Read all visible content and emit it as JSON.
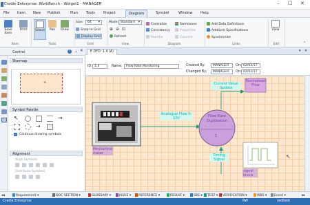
{
  "window": {
    "title": "Cradle Enterprise: WorkBench - Widget1 - MANAGER"
  },
  "menu": {
    "items": [
      "File",
      "Item",
      "New",
      "Publish",
      "Plan",
      "Tools",
      "Project",
      "Diagram",
      "Symbol",
      "Window",
      "Help"
    ],
    "active": "Diagram"
  },
  "ribbon": {
    "groups": [
      "Item",
      "Tools",
      "Grid",
      "View",
      "Diagram",
      "Links",
      "Edit"
    ],
    "item": {
      "save": "Save Item",
      "print": "Print"
    },
    "tools": {
      "select": "Select",
      "pan": "Pan",
      "draw": "Draw"
    },
    "grid": {
      "size_label": "Size:",
      "size_value": "64",
      "snap": "Snap to Grid",
      "display": "Display Grid"
    },
    "view": {
      "mode_label": "Mode:",
      "mode_value": "Standard",
      "refresh": "Refresh"
    },
    "diagram": {
      "centralise": "Centralise",
      "consistency": "Consistency",
      "reorder": "Reorder",
      "swimlanes": "Swimlanes",
      "properties": "Properties",
      "convert": "Convert"
    },
    "links": {
      "add_defs": "Add Data Definitions",
      "add_specs": "Add/Link Specifications",
      "synchronise": "Synchronise"
    },
    "edit": {
      "view": "View"
    }
  },
  "control": {
    "title": "Control",
    "starmap": "Starmap",
    "symbol_palette": "Symbol Palette",
    "continue_drawing": "Continue drawing symbols",
    "alignment": "Alignment",
    "align_symbols": "Align Symbols",
    "distribute_symbols": "Distribute Symbols"
  },
  "doc": {
    "tab": "E DFD: 1.4 (A)",
    "id_label": "ID:",
    "id_value": "1.4",
    "name_label": "Name:",
    "name_value": "Flow Rate Monitoring",
    "created_by_label": "Created By:",
    "created_by": "MANAGER",
    "created_on_label": "On:",
    "created_on": "02/02/17",
    "changed_by_label": "Changed By:",
    "changed_by": "MANAGER",
    "changed_on_label": "On:",
    "changed_on": "02/02/17"
  },
  "diagram": {
    "process_title": "Flow Rate Digitisation",
    "process_number": "1",
    "flows": {
      "analogue": "Analogue Flow 0-10V",
      "current_value": "Current Value Update",
      "timing": "Timing Signal"
    },
    "store": "Normalised Flow",
    "labels": {
      "meter": "Mechanical meter",
      "levels": "signal levels"
    }
  },
  "tabs": [
    "Requirement",
    "DOC SECTION",
    "GLOSSARY",
    "ISSUE",
    "REFERENCE",
    "RESULT",
    "SBS",
    "TEST",
    "VERIFICATION",
    "WBS",
    "Event"
  ],
  "status": {
    "app": "Cradle Enterprise",
    "mode": "RW",
    "state": "(edited)"
  },
  "colors": {
    "accent": "#2f6db5",
    "canvas": "#fde8cf",
    "process": "#c9a0dc",
    "flow": "#1a9e83",
    "flow_text": "#00b3a6",
    "store_fill": "#d9a8e3"
  }
}
